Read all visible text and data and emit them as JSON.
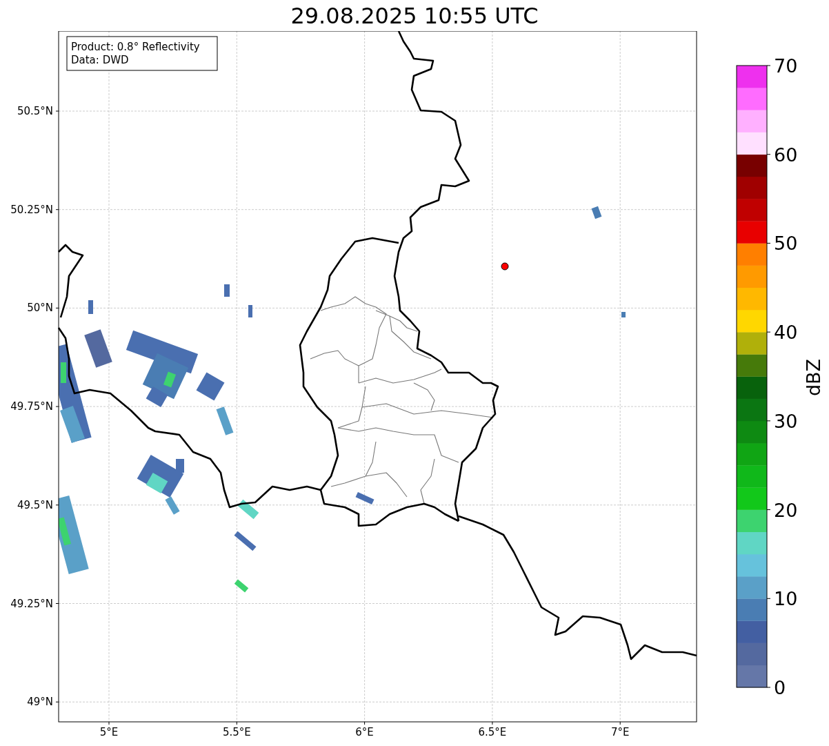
{
  "title": "29.08.2025 10:55 UTC",
  "info_box": [
    "Product: 0.8° Reflectivity",
    "Data: DWD"
  ],
  "map": {
    "lat_labels": [
      "50.5°N",
      "50.25°N",
      "50°N",
      "49.75°N",
      "49.5°N",
      "49.25°N",
      "49°N"
    ],
    "lon_labels": [
      "5°E",
      "5.5°E",
      "6°E",
      "6.5°E",
      "7°E"
    ]
  },
  "colorbar": {
    "label": "dBZ",
    "ticks": [
      "70",
      "60",
      "50",
      "40",
      "30",
      "20",
      "10",
      "0"
    ],
    "bands": [
      {
        "color": "#6577a8"
      },
      {
        "color": "#54699f"
      },
      {
        "color": "#435fa2"
      },
      {
        "color": "#4a7db3"
      },
      {
        "color": "#5aa0c8"
      },
      {
        "color": "#66c2dc"
      },
      {
        "color": "#60d6c4"
      },
      {
        "color": "#3dd36f"
      },
      {
        "color": "#12c81a"
      },
      {
        "color": "#10b81a"
      },
      {
        "color": "#10a514"
      },
      {
        "color": "#0e8a12"
      },
      {
        "color": "#0b7612"
      },
      {
        "color": "#08620c"
      },
      {
        "color": "#467a0a"
      },
      {
        "color": "#b0b00a"
      },
      {
        "color": "#ffd700"
      },
      {
        "color": "#ffb800"
      },
      {
        "color": "#ff9a00"
      },
      {
        "color": "#ff7f00"
      },
      {
        "color": "#e80000"
      },
      {
        "color": "#c00000"
      },
      {
        "color": "#a00000"
      },
      {
        "color": "#780000"
      },
      {
        "color": "#ffe0ff"
      },
      {
        "color": "#ffb0ff"
      },
      {
        "color": "#ff6cff"
      },
      {
        "color": "#ee30ee"
      }
    ]
  }
}
